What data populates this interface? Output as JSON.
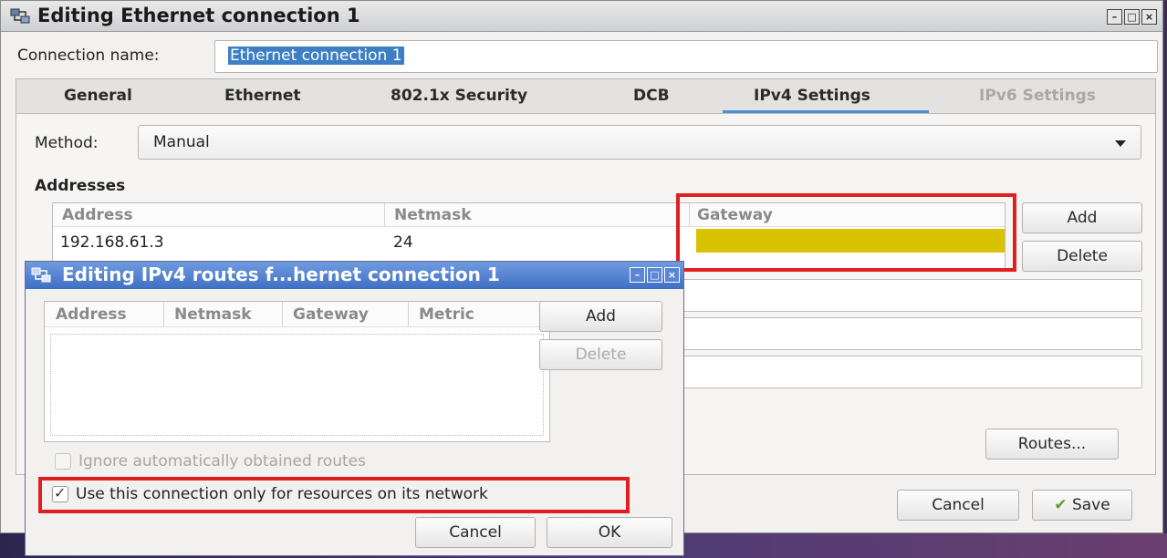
{
  "main_window": {
    "title": "Editing Ethernet connection 1",
    "connection_name_label": "Connection name:",
    "connection_name_value": "Ethernet connection 1",
    "tabs": [
      {
        "label": "General",
        "active": false,
        "enabled": true
      },
      {
        "label": "Ethernet",
        "active": false,
        "enabled": true
      },
      {
        "label": "802.1x Security",
        "active": false,
        "enabled": true
      },
      {
        "label": "DCB",
        "active": false,
        "enabled": true
      },
      {
        "label": "IPv4 Settings",
        "active": true,
        "enabled": true
      },
      {
        "label": "IPv6 Settings",
        "active": false,
        "enabled": false
      }
    ],
    "method_label": "Method:",
    "method_value": "Manual",
    "addresses_heading": "Addresses",
    "addresses_columns": [
      "Address",
      "Netmask",
      "Gateway"
    ],
    "addresses_rows": [
      {
        "address": "192.168.61.3",
        "netmask": "24",
        "gateway": ""
      }
    ],
    "add_button": "Add",
    "delete_button": "Delete",
    "routes_button": "Routes...",
    "cancel_button": "Cancel",
    "save_button": "Save",
    "highlight_color": "#d9c200",
    "annotation_color": "#e02020"
  },
  "routes_dialog": {
    "title": "Editing IPv4 routes f...hernet connection 1",
    "columns": [
      "Address",
      "Netmask",
      "Gateway",
      "Metric"
    ],
    "add_button": "Add",
    "delete_button": "Delete",
    "ignore_routes_label": "Ignore automatically obtained routes",
    "ignore_routes_checked": false,
    "ignore_routes_enabled": false,
    "only_resources_label": "Use this connection only for resources on its network",
    "only_resources_checked": true,
    "cancel_button": "Cancel",
    "ok_button": "OK"
  },
  "icons": {
    "window_icon": "network-connection-icon",
    "minimize": "minimize-icon",
    "maximize": "maximize-icon",
    "close": "close-icon",
    "dropdown": "chevron-down-icon",
    "save": "checkmark-icon",
    "checkbox_tick": "check-icon"
  }
}
